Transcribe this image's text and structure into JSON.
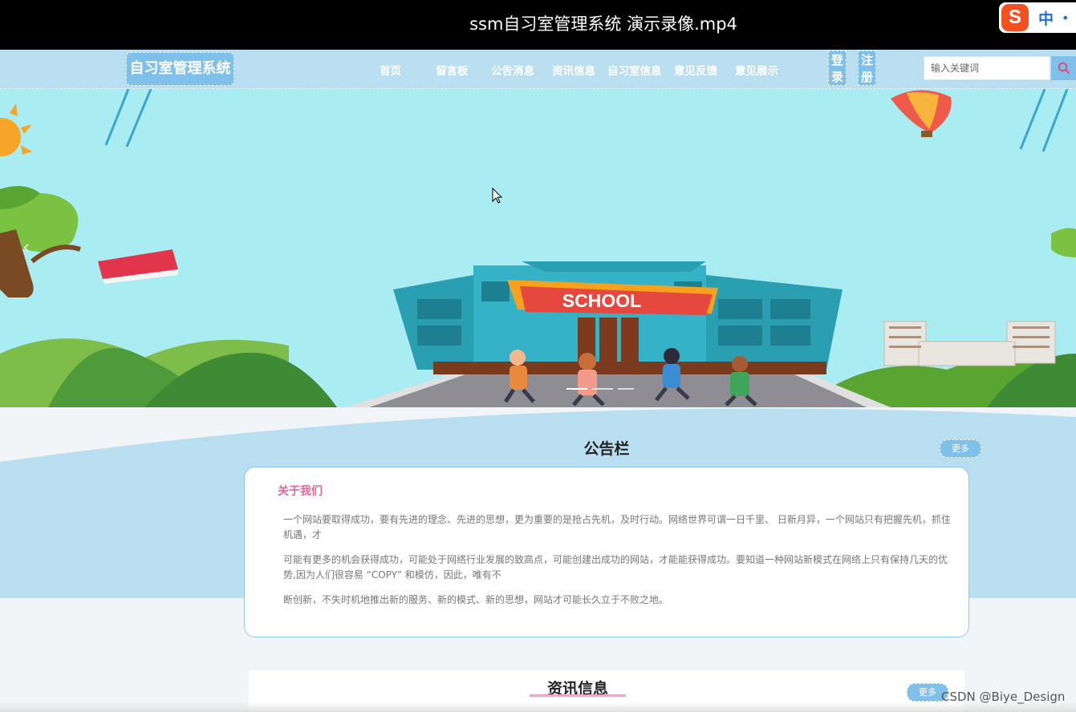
{
  "video": {
    "title": "ssm自习室管理系统 演示录像.mp4"
  },
  "ime": {
    "logo": "S",
    "mode": "中",
    "extra": "•"
  },
  "nav": {
    "brand": "自习室管理系统",
    "items": [
      "首页",
      "留言板",
      "公告消息",
      "资讯信息",
      "自习室信息",
      "意见反馈",
      "意见展示"
    ],
    "login": [
      "登",
      "录"
    ],
    "register": [
      "注",
      "册"
    ],
    "search_placeholder": "输入关键词"
  },
  "banner": {
    "sign_text": "SCHOOL"
  },
  "notice": {
    "title": "公告栏",
    "more_label": "更多",
    "card_title": "关于我们",
    "paragraphs": [
      "一个网站要取得成功，要有先进的理念、先进的思想，更为重要的是抢占先机，及时行动。网络世界可谓一日千里、 日新月异，一个网站只有把握先机，抓住机遇，才",
      "可能有更多的机会获得成功，可能处于网络行业发展的致高点，可能创建出成功的网站，才能能获得成功。要知道一种网站新模式在网络上只有保持几天的优势,因为人们很容易 “COPY” 和模仿，因此，唯有不",
      "断创新，不失时机地推出新的服务、新的模式、新的思想，网站才可能长久立于不败之地。"
    ]
  },
  "news": {
    "title": "资讯信息",
    "more_label": "更多"
  },
  "watermark": "CSDN @Biye_Design",
  "colors": {
    "nav_bg": "#b8def0",
    "accent": "#7fc0ea",
    "pink": "#e0679a"
  }
}
